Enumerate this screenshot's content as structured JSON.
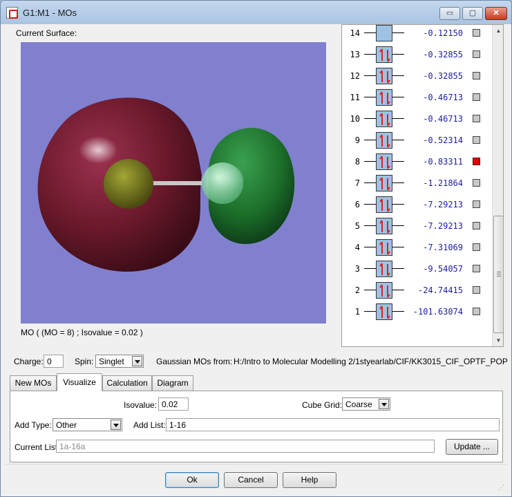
{
  "window": {
    "title": "G1:M1 - MOs",
    "controls": {
      "minimize": "▭",
      "maximize": "▢",
      "close": "✕"
    }
  },
  "surface": {
    "label": "Current Surface:",
    "caption": "MO ( (MO = 8) ; Isovalue = 0.02 )",
    "background_color": "#8080ce",
    "lobe_colors": {
      "negative": "#7b1d32",
      "positive": "#1f7a2f"
    }
  },
  "mo_list": {
    "orbitals": [
      {
        "number": "14",
        "energy": "-0.12150",
        "occupied": false,
        "selected": false
      },
      {
        "number": "13",
        "energy": "-0.32855",
        "occupied": true,
        "selected": false
      },
      {
        "number": "12",
        "energy": "-0.32855",
        "occupied": true,
        "selected": false
      },
      {
        "number": "11",
        "energy": "-0.46713",
        "occupied": true,
        "selected": false
      },
      {
        "number": "10",
        "energy": "-0.46713",
        "occupied": true,
        "selected": false
      },
      {
        "number": "9",
        "energy": "-0.52314",
        "occupied": true,
        "selected": false
      },
      {
        "number": "8",
        "energy": "-0.83311",
        "occupied": true,
        "selected": true
      },
      {
        "number": "7",
        "energy": "-1.21864",
        "occupied": true,
        "selected": false
      },
      {
        "number": "6",
        "energy": "-7.29213",
        "occupied": true,
        "selected": false
      },
      {
        "number": "5",
        "energy": "-7.29213",
        "occupied": true,
        "selected": false
      },
      {
        "number": "4",
        "energy": "-7.31069",
        "occupied": true,
        "selected": false
      },
      {
        "number": "3",
        "energy": "-9.54057",
        "occupied": true,
        "selected": false
      },
      {
        "number": "2",
        "energy": "-24.74415",
        "occupied": true,
        "selected": false
      },
      {
        "number": "1",
        "energy": "-101.63074",
        "occupied": true,
        "selected": false
      }
    ],
    "colors": {
      "box": "#9ec2e4",
      "electron_arrow": "#e02020",
      "selected_check": "#e00000",
      "energy_text": "#1c1ca0"
    }
  },
  "info_row": {
    "charge_label": "Charge:",
    "charge_value": "0",
    "spin_label": "Spin:",
    "spin_value": "Singlet",
    "source_label": "Gaussian MOs from:",
    "source_path": "H:/Intro to Molecular Modelling 2/1styearlab/CIF/KK3015_CIF_OPTF_POP"
  },
  "tabs": [
    {
      "label": "New MOs",
      "active": false
    },
    {
      "label": "Visualize",
      "active": true
    },
    {
      "label": "Calculation",
      "active": false
    },
    {
      "label": "Diagram",
      "active": false
    }
  ],
  "visualize": {
    "isovalue_label": "Isovalue:",
    "isovalue_value": "0.02",
    "cube_grid_label": "Cube Grid:",
    "cube_grid_value": "Coarse",
    "add_type_label": "Add Type:",
    "add_type_value": "Other",
    "add_list_label": "Add List:",
    "add_list_value": "1-16",
    "current_list_label": "Current List:",
    "current_list_value": "1a-16a",
    "update_button": "Update ..."
  },
  "footer": {
    "ok": "Ok",
    "cancel": "Cancel",
    "help": "Help"
  }
}
